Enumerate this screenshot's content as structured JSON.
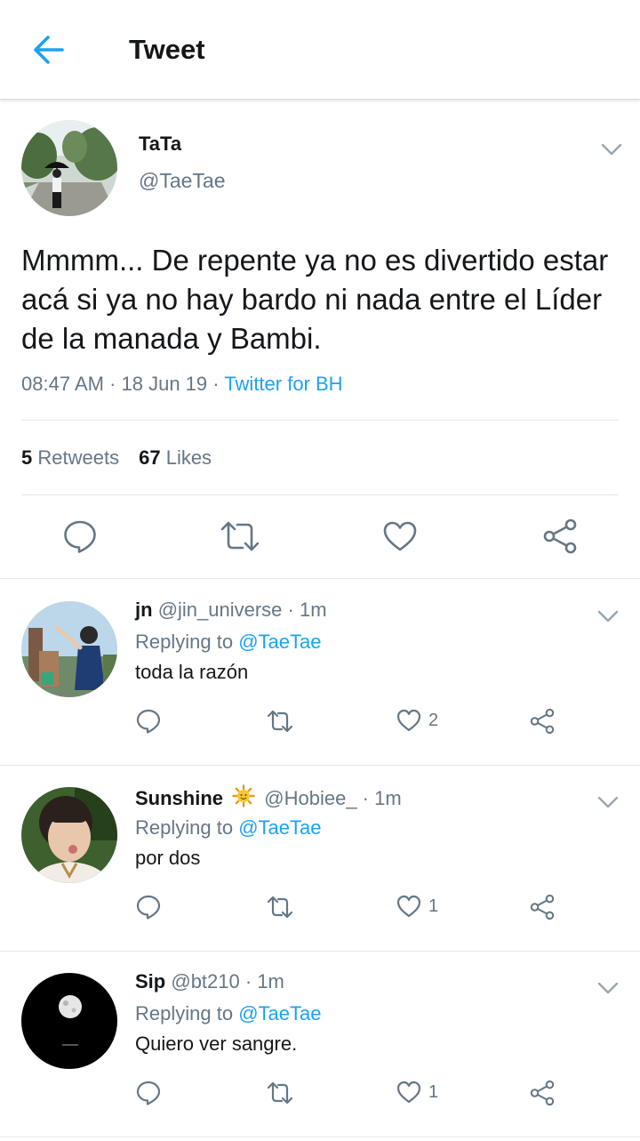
{
  "header": {
    "title": "Tweet"
  },
  "tweet": {
    "name": "TaTa",
    "handle": "@TaeTae",
    "text": "Mmmm... De repente ya no es divertido estar acá si ya no hay bardo ni nada entre el Líder de la manada y Bambi.",
    "time": "08:47 AM",
    "date": "18 Jun 19",
    "source": "Twitter for BH",
    "sep": " · ",
    "retweets_count": "5",
    "retweets_label": "Retweets",
    "likes_count": "67",
    "likes_label": "Likes"
  },
  "replies": [
    {
      "name": "jn",
      "handle": "@jin_universe",
      "time": "1m",
      "replying_label": "Replying to",
      "mention": "@TaeTae",
      "text": "toda la razón",
      "likes": "2"
    },
    {
      "name": "Sunshine",
      "handle": "@Hobiee_",
      "time": "1m",
      "replying_label": "Replying to",
      "mention": "@TaeTae",
      "text": "por dos",
      "likes": "1"
    },
    {
      "name": "Sip",
      "handle": "@bt210",
      "time": "1m",
      "replying_label": "Replying to",
      "mention": "@TaeTae",
      "text": "Quiero ver sangre.",
      "likes": "1"
    }
  ],
  "icons": {
    "back": "arrow-left-icon",
    "chevron": "chevron-down-icon",
    "reply": "comment-icon",
    "retweet": "retweet-icon",
    "like": "heart-icon",
    "share": "share-icon",
    "emoji": "sun-emoji-icon"
  },
  "colors": {
    "accent": "#1da1f2",
    "secondary_text": "#657786",
    "primary_text": "#14171a",
    "divider": "#e1e8ed"
  }
}
